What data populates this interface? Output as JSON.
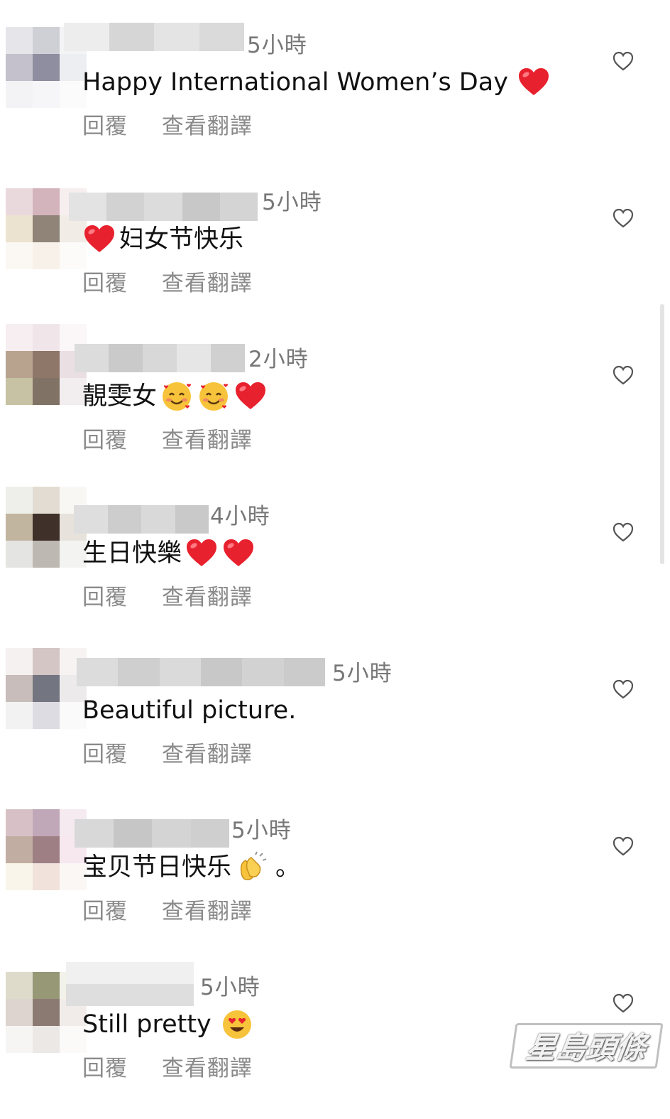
{
  "comments": [
    {
      "time": "5小時",
      "text": "Happy International Women’s Day",
      "emojis": [
        "heart-emoji"
      ],
      "reply_label": "回覆",
      "translate_label": "查看翻譯"
    },
    {
      "time": "5小時",
      "text": "妇女节快乐",
      "emojis_before": [
        "heart-emoji"
      ],
      "reply_label": "回覆",
      "translate_label": "查看翻譯"
    },
    {
      "time": "2小時",
      "text": "靚雯女",
      "emojis": [
        "smiling-face-with-hearts-emoji",
        "smiling-face-with-hearts-emoji",
        "heart-emoji"
      ],
      "reply_label": "回覆",
      "translate_label": "查看翻譯"
    },
    {
      "time": "4小時",
      "text": "生日快樂",
      "emojis": [
        "heart-emoji",
        "heart-emoji"
      ],
      "reply_label": "回覆",
      "translate_label": "查看翻譯"
    },
    {
      "time": "5小時",
      "text": "Beautiful picture.",
      "emojis": [],
      "reply_label": "回覆",
      "translate_label": "查看翻譯"
    },
    {
      "time": "5小時",
      "text": "宝贝节日快乐",
      "emojis": [
        "clapping-hands-emoji"
      ],
      "text_after": "。",
      "reply_label": "回覆",
      "translate_label": "查看翻譯"
    },
    {
      "time": "5小時",
      "text": "Still pretty",
      "emojis": [
        "heart-eyes-emoji"
      ],
      "reply_label": "回覆",
      "translate_label": "查看翻譯"
    }
  ],
  "watermark": "星島頭條",
  "colors": {
    "text": "#111111",
    "muted": "#8a8a8a",
    "heart_red": "#e8212e",
    "emoji_yellow": "#f7c33a"
  },
  "icons": {
    "like": "heart-outline-icon"
  }
}
